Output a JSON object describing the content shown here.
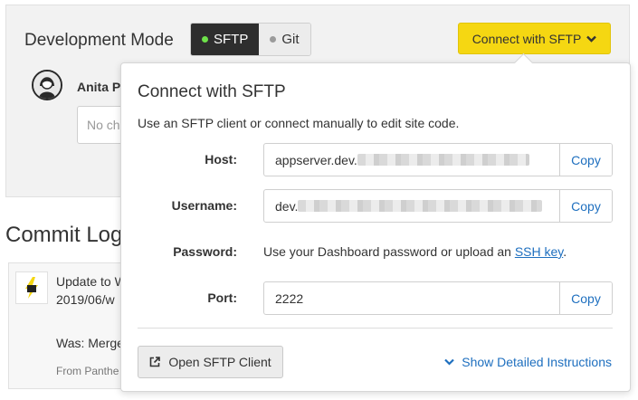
{
  "dev_mode": {
    "title": "Development Mode",
    "modes": [
      {
        "label": "SFTP",
        "active": true
      },
      {
        "label": "Git",
        "active": false
      }
    ],
    "connect_button": "Connect with SFTP",
    "author": "Anita P",
    "commit_placeholder": "No ch"
  },
  "commit_log": {
    "title": "Commit Log",
    "entry": {
      "line1": "Update to W",
      "line2": "2019/06/w",
      "line3": "Was: Merge",
      "from": "From Panthe"
    }
  },
  "popover": {
    "title": "Connect with SFTP",
    "description": "Use an SFTP client or connect manually to edit site code.",
    "host": {
      "label": "Host:",
      "value_prefix": "appserver.dev.",
      "copy": "Copy"
    },
    "username": {
      "label": "Username:",
      "value_prefix": "dev.",
      "copy": "Copy"
    },
    "password": {
      "label": "Password:",
      "text": "Use your Dashboard password or upload an ",
      "link": "SSH key",
      "suffix": "."
    },
    "port": {
      "label": "Port:",
      "value": "2222",
      "copy": "Copy"
    },
    "open_button": "Open SFTP Client",
    "show_instructions": "Show Detailed Instructions"
  },
  "colors": {
    "accent_yellow": "#f5d712",
    "link_blue": "#1e6fbf",
    "active_dot": "#6ee24a"
  },
  "icons": [
    "chevron-down-icon",
    "external-link-icon",
    "avatar-icon",
    "pantheon-bolt-icon"
  ]
}
